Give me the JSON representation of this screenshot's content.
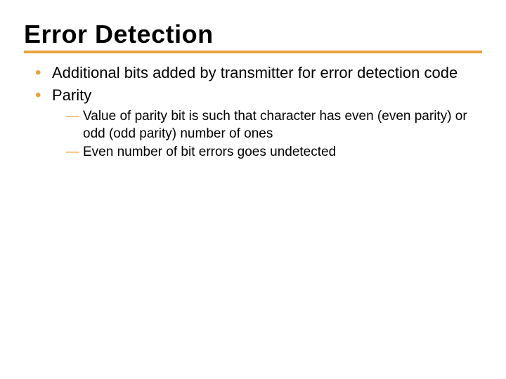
{
  "title": "Error Detection",
  "bullets": [
    {
      "text": "Additional bits added by transmitter for error detection code",
      "sub": []
    },
    {
      "text": "Parity",
      "sub": [
        "Value of parity bit is such that character has even (even parity) or odd (odd parity) number of ones",
        "Even number of bit errors goes undetected"
      ]
    }
  ]
}
